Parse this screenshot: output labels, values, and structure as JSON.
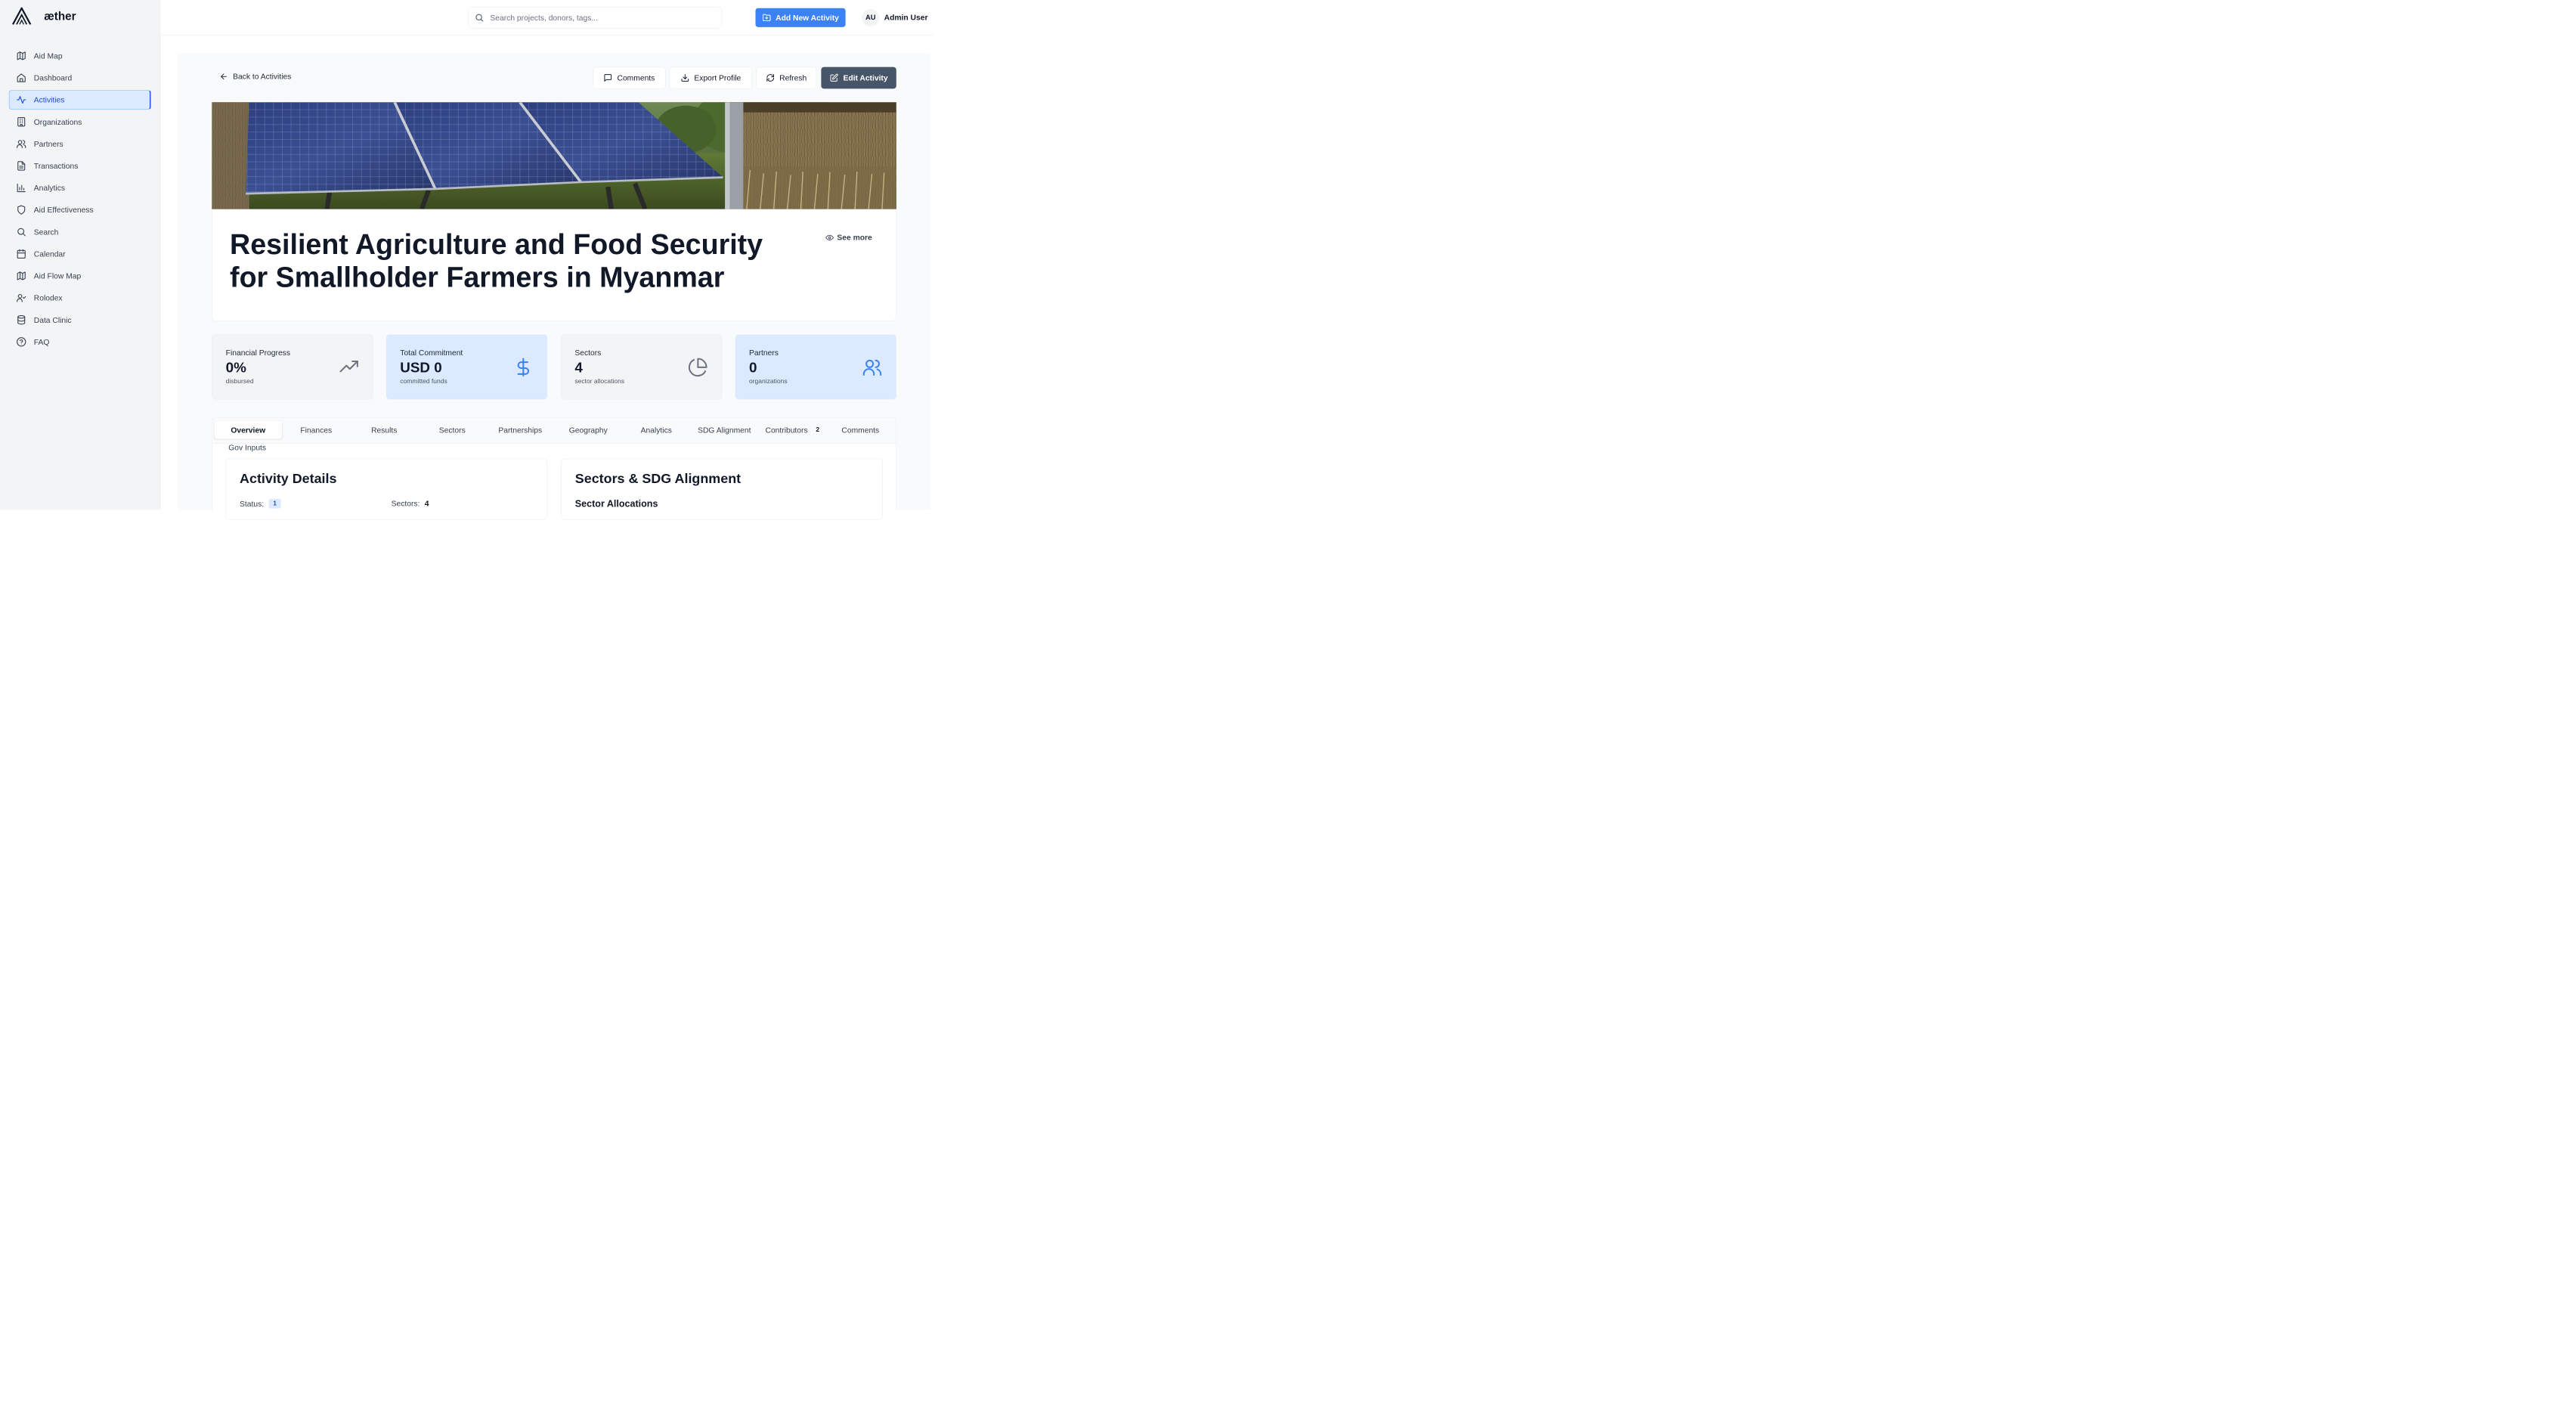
{
  "app": {
    "name": "æther"
  },
  "sidebar": {
    "items": [
      {
        "label": "Aid Map",
        "icon": "map-icon",
        "active": false
      },
      {
        "label": "Dashboard",
        "icon": "home-icon",
        "active": false
      },
      {
        "label": "Activities",
        "icon": "activity-icon",
        "active": true
      },
      {
        "label": "Organizations",
        "icon": "building-icon",
        "active": false
      },
      {
        "label": "Partners",
        "icon": "users-icon",
        "active": false
      },
      {
        "label": "Transactions",
        "icon": "file-text-icon",
        "active": false
      },
      {
        "label": "Analytics",
        "icon": "bar-chart-icon",
        "active": false
      },
      {
        "label": "Aid Effectiveness",
        "icon": "shield-icon",
        "active": false
      },
      {
        "label": "Search",
        "icon": "search-icon",
        "active": false
      },
      {
        "label": "Calendar",
        "icon": "calendar-icon",
        "active": false
      },
      {
        "label": "Aid Flow Map",
        "icon": "map-icon",
        "active": false
      },
      {
        "label": "Rolodex",
        "icon": "user-check-icon",
        "active": false
      },
      {
        "label": "Data Clinic",
        "icon": "database-icon",
        "active": false
      },
      {
        "label": "FAQ",
        "icon": "help-circle-icon",
        "active": false
      }
    ]
  },
  "topbar": {
    "search_placeholder": "Search projects, donors, tags...",
    "search_value": "",
    "add_button": "Add New Activity",
    "user_initials": "AU",
    "user_name": "Admin User"
  },
  "toolbar": {
    "back": "Back to Activities",
    "comments": "Comments",
    "export": "Export Profile",
    "refresh": "Refresh",
    "edit": "Edit Activity"
  },
  "activity": {
    "title": "Resilient Agriculture and Food Security for Smallholder Farmers in Myanmar",
    "see_more": "See more"
  },
  "stats": [
    {
      "label": "Financial Progress",
      "value": "0%",
      "sub": "disbursed",
      "icon": "trending-up-icon"
    },
    {
      "label": "Total Commitment",
      "value": "USD 0",
      "sub": "committed funds",
      "icon": "dollar-icon"
    },
    {
      "label": "Sectors",
      "value": "4",
      "sub": "sector allocations",
      "icon": "pie-chart-icon"
    },
    {
      "label": "Partners",
      "value": "0",
      "sub": "organizations",
      "icon": "users-icon"
    }
  ],
  "tabs": [
    {
      "label": "Overview",
      "active": true
    },
    {
      "label": "Finances"
    },
    {
      "label": "Results"
    },
    {
      "label": "Sectors"
    },
    {
      "label": "Partnerships"
    },
    {
      "label": "Geography"
    },
    {
      "label": "Analytics"
    },
    {
      "label": "SDG Alignment"
    },
    {
      "label": "Contributors",
      "badge": "2"
    },
    {
      "label": "Comments"
    },
    {
      "label": "Gov Inputs"
    }
  ],
  "activity_details": {
    "title": "Activity Details",
    "status_label": "Status:",
    "status_value": "1",
    "sectors_label": "Sectors:",
    "sectors_value": "4"
  },
  "sectors_sdg": {
    "title": "Sectors & SDG Alignment",
    "subtitle": "Sector Allocations"
  },
  "colors": {
    "accent": "#3b82f6",
    "active_nav": "#dbeafe",
    "dark_button": "#475569",
    "stat_icon_blue": "#3b82f6",
    "stat_icon_grey": "#6b7280"
  }
}
